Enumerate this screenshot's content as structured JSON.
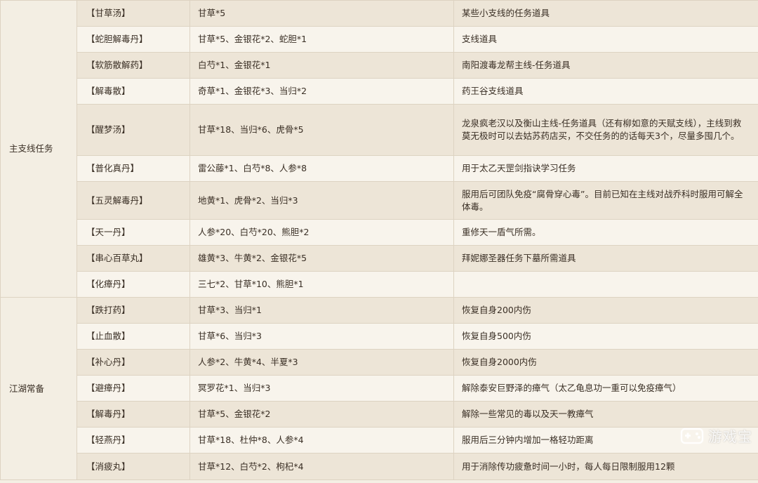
{
  "categories": [
    {
      "label": "主支线任务",
      "rows": [
        {
          "name": "【甘草汤】",
          "recipe": "甘草*5",
          "desc": "某些小支线的任务道具"
        },
        {
          "name": "【蛇胆解毒丹】",
          "recipe": "甘草*5、金银花*2、蛇胆*1",
          "desc": "支线道具"
        },
        {
          "name": "【软筋散解药】",
          "recipe": "白芍*1、金银花*1",
          "desc": "南阳渡毒龙帮主线-任务道具"
        },
        {
          "name": "【解毒散】",
          "recipe": "奇草*1、金银花*3、当归*2",
          "desc": "药王谷支线道具"
        },
        {
          "name": "【醒梦汤】",
          "recipe": "甘草*18、当归*6、虎骨*5",
          "desc": "龙泉疯老汉以及衡山主线-任务道具（还有柳如意的天赋支线），主线到救莫无极时可以去姑苏药店买，不交任务的的话每天3个，尽量多囤几个。"
        },
        {
          "name": "【普化真丹】",
          "recipe": "雷公藤*1、白芍*8、人参*8",
          "desc": "用于太乙天罡剑指诀学习任务"
        },
        {
          "name": "【五灵解毒丹】",
          "recipe": "地黄*1、虎骨*2、当归*3",
          "desc": "服用后可团队免疫“腐骨穿心毒”。目前已知在主线对战乔科时服用可解全体毒。"
        },
        {
          "name": "【天一丹】",
          "recipe": "人参*20、白芍*20、熊胆*2",
          "desc": "重修天一盾气所需。"
        },
        {
          "name": "【串心百草丸】",
          "recipe": "雄黄*3、牛黄*2、金银花*5",
          "desc": "拜妮娜圣器任务下墓所需道具"
        },
        {
          "name": "【化瘴丹】",
          "recipe": "三七*2、甘草*10、熊胆*1",
          "desc": ""
        }
      ]
    },
    {
      "label": "江湖常备",
      "rows": [
        {
          "name": "【跌打药】",
          "recipe": "甘草*3、当归*1",
          "desc": "恢复自身200内伤"
        },
        {
          "name": "【止血散】",
          "recipe": "甘草*6、当归*3",
          "desc": "恢复自身500内伤"
        },
        {
          "name": "【补心丹】",
          "recipe": "人参*2、牛黄*4、半夏*3",
          "desc": "恢复自身2000内伤"
        },
        {
          "name": "【避瘴丹】",
          "recipe": "冥罗花*1、当归*3",
          "desc": "解除泰安巨野泽的瘴气（太乙龟息功一重可以免疫瘴气）"
        },
        {
          "name": "【解毒丹】",
          "recipe": "甘草*5、金银花*2",
          "desc": "解除一些常见的毒以及天一教瘴气"
        },
        {
          "name": "【轻燕丹】",
          "recipe": "甘草*18、杜仲*8、人参*4",
          "desc": "服用后三分钟内增加一格轻功距离"
        },
        {
          "name": "【消疲丸】",
          "recipe": "甘草*12、白芍*2、枸杞*4",
          "desc": "用于消除传功疲惫时间一小时，每人每日限制服用12颗"
        }
      ]
    }
  ],
  "watermark": {
    "text": "游戏宝",
    "icon": "gamepad-icon"
  }
}
